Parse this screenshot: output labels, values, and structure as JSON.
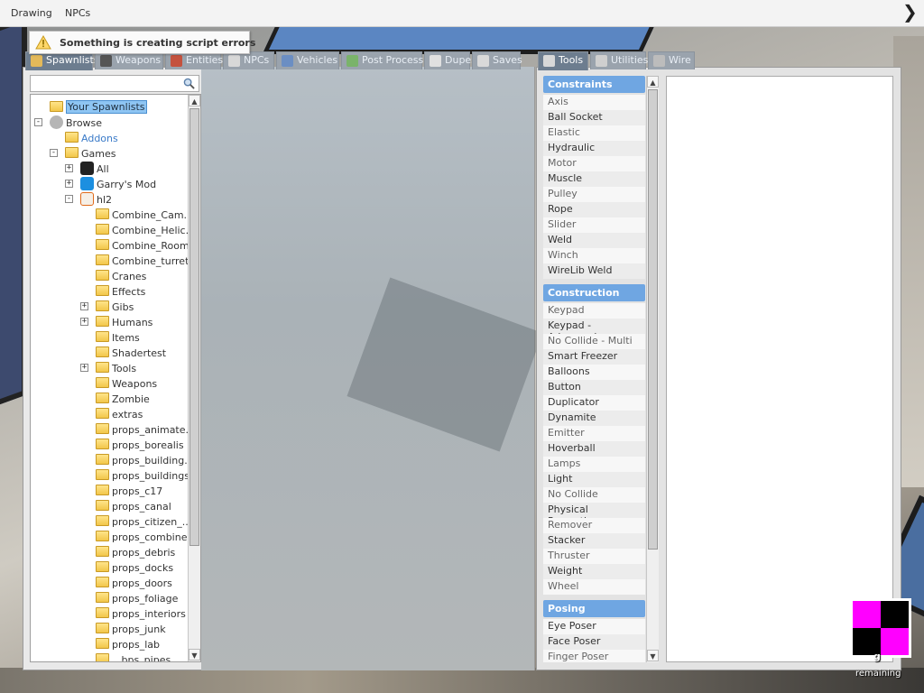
{
  "menubar": {
    "items": [
      "Drawing",
      "NPCs"
    ],
    "arrow_icon": "chevron-right-icon"
  },
  "toast": {
    "message": "Something is creating script errors",
    "icon": "warning-icon"
  },
  "left_tabs": [
    {
      "label": "Spawnlists",
      "icon": "grid-icon",
      "color": "#e3b95a"
    },
    {
      "label": "Weapons",
      "icon": "gun-icon",
      "color": "#555555"
    },
    {
      "label": "Entities",
      "icon": "box-icon",
      "color": "#c4523e"
    },
    {
      "label": "NPCs",
      "icon": "npc-icon",
      "color": "#d8d8d8"
    },
    {
      "label": "Vehicles",
      "icon": "car-icon",
      "color": "#6b8ec3"
    },
    {
      "label": "Post Process",
      "icon": "image-icon",
      "color": "#7ab36a"
    },
    {
      "label": "Dupes",
      "icon": "dupe-icon",
      "color": "#e0e0e0"
    },
    {
      "label": "Saves",
      "icon": "save-icon",
      "color": "#d9d9d9"
    }
  ],
  "right_tabs": [
    {
      "label": "Tools",
      "icon": "wrench-icon",
      "color": "#d8d8d8"
    },
    {
      "label": "Utilities",
      "icon": "utilities-icon",
      "color": "#cfcfcf"
    },
    {
      "label": "Wire",
      "icon": "wire-icon",
      "color": "#bcbcbc"
    }
  ],
  "spawnlist": {
    "search_placeholder": "",
    "tree": [
      {
        "label": "Your Spawnlists",
        "indent": 0,
        "expander": "",
        "icon": "folder",
        "selected": true
      },
      {
        "label": "Browse",
        "indent": 0,
        "expander": "-",
        "icon": "gear"
      },
      {
        "label": "Addons",
        "indent": 1,
        "expander": "",
        "icon": "folder",
        "link": true
      },
      {
        "label": "Games",
        "indent": 1,
        "expander": "-",
        "icon": "folder"
      },
      {
        "label": "All",
        "indent": 2,
        "expander": "+",
        "icon": "steam"
      },
      {
        "label": "Garry's Mod",
        "indent": 2,
        "expander": "+",
        "icon": "gmod"
      },
      {
        "label": "hl2",
        "indent": 2,
        "expander": "-",
        "icon": "hl2"
      },
      {
        "label": "Combine_Cam...",
        "indent": 3,
        "expander": "",
        "icon": "folder"
      },
      {
        "label": "Combine_Helic...",
        "indent": 3,
        "expander": "",
        "icon": "folder"
      },
      {
        "label": "Combine_Room",
        "indent": 3,
        "expander": "",
        "icon": "folder"
      },
      {
        "label": "Combine_turrets",
        "indent": 3,
        "expander": "",
        "icon": "folder"
      },
      {
        "label": "Cranes",
        "indent": 3,
        "expander": "",
        "icon": "folder"
      },
      {
        "label": "Effects",
        "indent": 3,
        "expander": "",
        "icon": "folder"
      },
      {
        "label": "Gibs",
        "indent": 3,
        "expander": "+",
        "icon": "folder"
      },
      {
        "label": "Humans",
        "indent": 3,
        "expander": "+",
        "icon": "folder"
      },
      {
        "label": "Items",
        "indent": 3,
        "expander": "",
        "icon": "folder"
      },
      {
        "label": "Shadertest",
        "indent": 3,
        "expander": "",
        "icon": "folder"
      },
      {
        "label": "Tools",
        "indent": 3,
        "expander": "+",
        "icon": "folder"
      },
      {
        "label": "Weapons",
        "indent": 3,
        "expander": "",
        "icon": "folder"
      },
      {
        "label": "Zombie",
        "indent": 3,
        "expander": "",
        "icon": "folder"
      },
      {
        "label": "extras",
        "indent": 3,
        "expander": "",
        "icon": "folder"
      },
      {
        "label": "props_animate...",
        "indent": 3,
        "expander": "",
        "icon": "folder"
      },
      {
        "label": "props_borealis",
        "indent": 3,
        "expander": "",
        "icon": "folder"
      },
      {
        "label": "props_building...",
        "indent": 3,
        "expander": "",
        "icon": "folder"
      },
      {
        "label": "props_buildings",
        "indent": 3,
        "expander": "",
        "icon": "folder"
      },
      {
        "label": "props_c17",
        "indent": 3,
        "expander": "",
        "icon": "folder"
      },
      {
        "label": "props_canal",
        "indent": 3,
        "expander": "",
        "icon": "folder"
      },
      {
        "label": "props_citizen_...",
        "indent": 3,
        "expander": "",
        "icon": "folder"
      },
      {
        "label": "props_combine",
        "indent": 3,
        "expander": "",
        "icon": "folder"
      },
      {
        "label": "props_debris",
        "indent": 3,
        "expander": "",
        "icon": "folder"
      },
      {
        "label": "props_docks",
        "indent": 3,
        "expander": "",
        "icon": "folder"
      },
      {
        "label": "props_doors",
        "indent": 3,
        "expander": "",
        "icon": "folder"
      },
      {
        "label": "props_foliage",
        "indent": 3,
        "expander": "",
        "icon": "folder"
      },
      {
        "label": "props_interiors",
        "indent": 3,
        "expander": "",
        "icon": "folder"
      },
      {
        "label": "props_junk",
        "indent": 3,
        "expander": "",
        "icon": "folder"
      },
      {
        "label": "props_lab",
        "indent": 3,
        "expander": "",
        "icon": "folder"
      },
      {
        "label": "...bps_pipes",
        "indent": 3,
        "expander": "",
        "icon": "folder"
      }
    ]
  },
  "tools": {
    "categories": [
      {
        "name": "Constraints",
        "items": [
          "Axis",
          "Ball Socket",
          "Elastic",
          "Hydraulic",
          "Motor",
          "Muscle",
          "Pulley",
          "Rope",
          "Slider",
          "Weld",
          "Winch",
          "WireLib Weld"
        ]
      },
      {
        "name": "Construction",
        "items": [
          "Keypad",
          "Keypad - Advanced",
          "No Collide - Multi",
          "Smart Freezer",
          "Balloons",
          "Button",
          "Duplicator",
          "Dynamite",
          "Emitter",
          "Hoverball",
          "Lamps",
          "Light",
          "No Collide",
          "Physical Properties",
          "Remover",
          "Stacker",
          "Thruster",
          "Weight",
          "Wheel"
        ]
      },
      {
        "name": "Posing",
        "items": [
          "Eye Poser",
          "Face Poser",
          "Finger Poser"
        ]
      }
    ]
  },
  "missing_texture": {
    "colors": [
      "#ff00ff",
      "#000000"
    ],
    "label": "remaining",
    "glyph": "g"
  }
}
